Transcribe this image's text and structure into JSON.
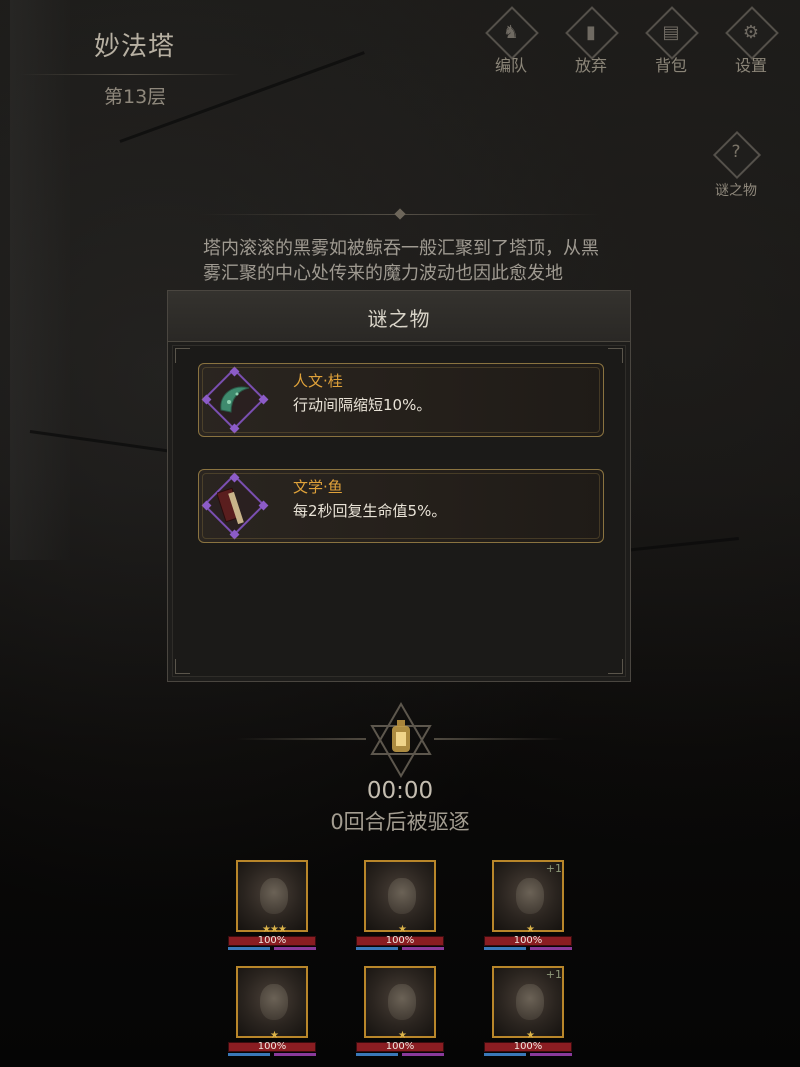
{
  "header": {
    "tower_name": "妙法塔",
    "floor": "第13层"
  },
  "top_buttons": [
    {
      "label": "编队",
      "icon": "helmet-icon"
    },
    {
      "label": "放弃",
      "icon": "exit-door-icon"
    },
    {
      "label": "背包",
      "icon": "bag-icon"
    },
    {
      "label": "设置",
      "icon": "gear-icon"
    }
  ],
  "mystery_button": {
    "label": "谜之物",
    "icon": "mystery-swirl-icon"
  },
  "story_text": "塔内滚滚的黑雾如被鲸吞一般汇聚到了塔顶，从黑雾汇聚的中心处传来的魔力波动也因此愈发地",
  "modal": {
    "title": "谜之物",
    "items": [
      {
        "name": "人文·桂",
        "description": "行动间隔缩短10%。",
        "icon": "jade-crescent-icon"
      },
      {
        "name": "文学·鱼",
        "description": "每2秒回复生命值5%。",
        "icon": "book-scroll-icon"
      }
    ]
  },
  "timer": "00:00",
  "evict_text": "0回合后被驱逐",
  "heroes": [
    {
      "hp": "100%",
      "plus": ""
    },
    {
      "hp": "100%",
      "plus": ""
    },
    {
      "hp": "100%",
      "plus": "+1"
    },
    {
      "hp": "100%",
      "plus": ""
    },
    {
      "hp": "100%",
      "plus": ""
    },
    {
      "hp": "100%",
      "plus": "+1"
    }
  ],
  "colors": {
    "item_name": "#e0a23a",
    "item_border": "#8a7340",
    "rarity_purple": "#7a4fb0",
    "hp_red": "#8a1d22",
    "portrait_gold": "#b8862a"
  }
}
